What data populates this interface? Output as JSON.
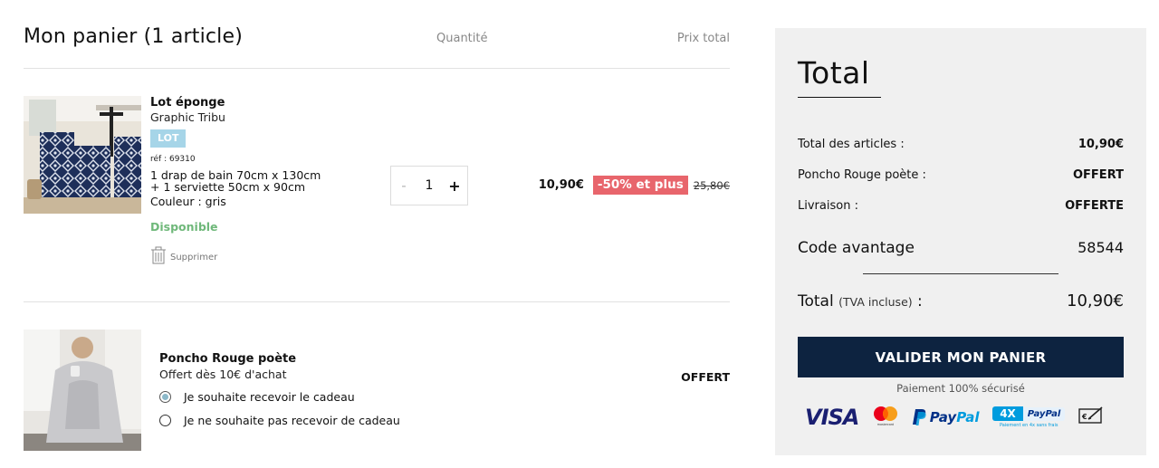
{
  "cart": {
    "title": "Mon panier (1 article)",
    "col_quantity": "Quantité",
    "col_total_price": "Prix total",
    "item": {
      "name": "Lot éponge",
      "subtitle": "Graphic Tribu",
      "badge": "LOT",
      "ref": "réf : 69310",
      "desc_line1": "1 drap de bain 70cm x 130cm",
      "desc_line2": "+ 1 serviette 50cm x 90cm",
      "color": "Couleur : gris",
      "availability": "Disponible",
      "delete_label": "Supprimer",
      "qty_minus": "-",
      "qty_value": "1",
      "qty_plus": "+",
      "price_now": "10,90€",
      "promo_badge": "-50% et plus",
      "price_old": "25,80€"
    },
    "gift": {
      "name": "Poncho Rouge poète",
      "subtitle": "Offert dès 10€ d'achat",
      "options": [
        {
          "label": "Je souhaite recevoir le cadeau",
          "checked": true
        },
        {
          "label": "Je ne souhaite pas recevoir de cadeau",
          "checked": false
        }
      ],
      "price": "OFFERT"
    }
  },
  "summary": {
    "title": "Total",
    "rows": [
      {
        "label": "Total des articles :",
        "value": "10,90€"
      },
      {
        "label": "Poncho Rouge poète :",
        "value": "OFFERT"
      },
      {
        "label": "Livraison :",
        "value": "OFFERTE"
      }
    ],
    "code_label": "Code avantage",
    "code_value": "58544",
    "total_label": "Total",
    "total_tva": "(TVA incluse)",
    "total_colon": " :",
    "total_value": "10,90€",
    "validate_button": "VALIDER MON PANIER",
    "secure_text": "Paiement 100% sécurisé",
    "payments": {
      "visa": "VISA",
      "mastercard_text": "mastercard",
      "paypal_part1": "Pay",
      "paypal_part2": "Pal",
      "fourx": "4X",
      "fourx_paypal": "PayPal",
      "fourx_sub": "Paiement en 4x sans frais"
    },
    "colors": {
      "button": "#0d2340",
      "promo": "#e8656c",
      "available": "#6fb87a",
      "badge": "#a6d5e8"
    }
  }
}
